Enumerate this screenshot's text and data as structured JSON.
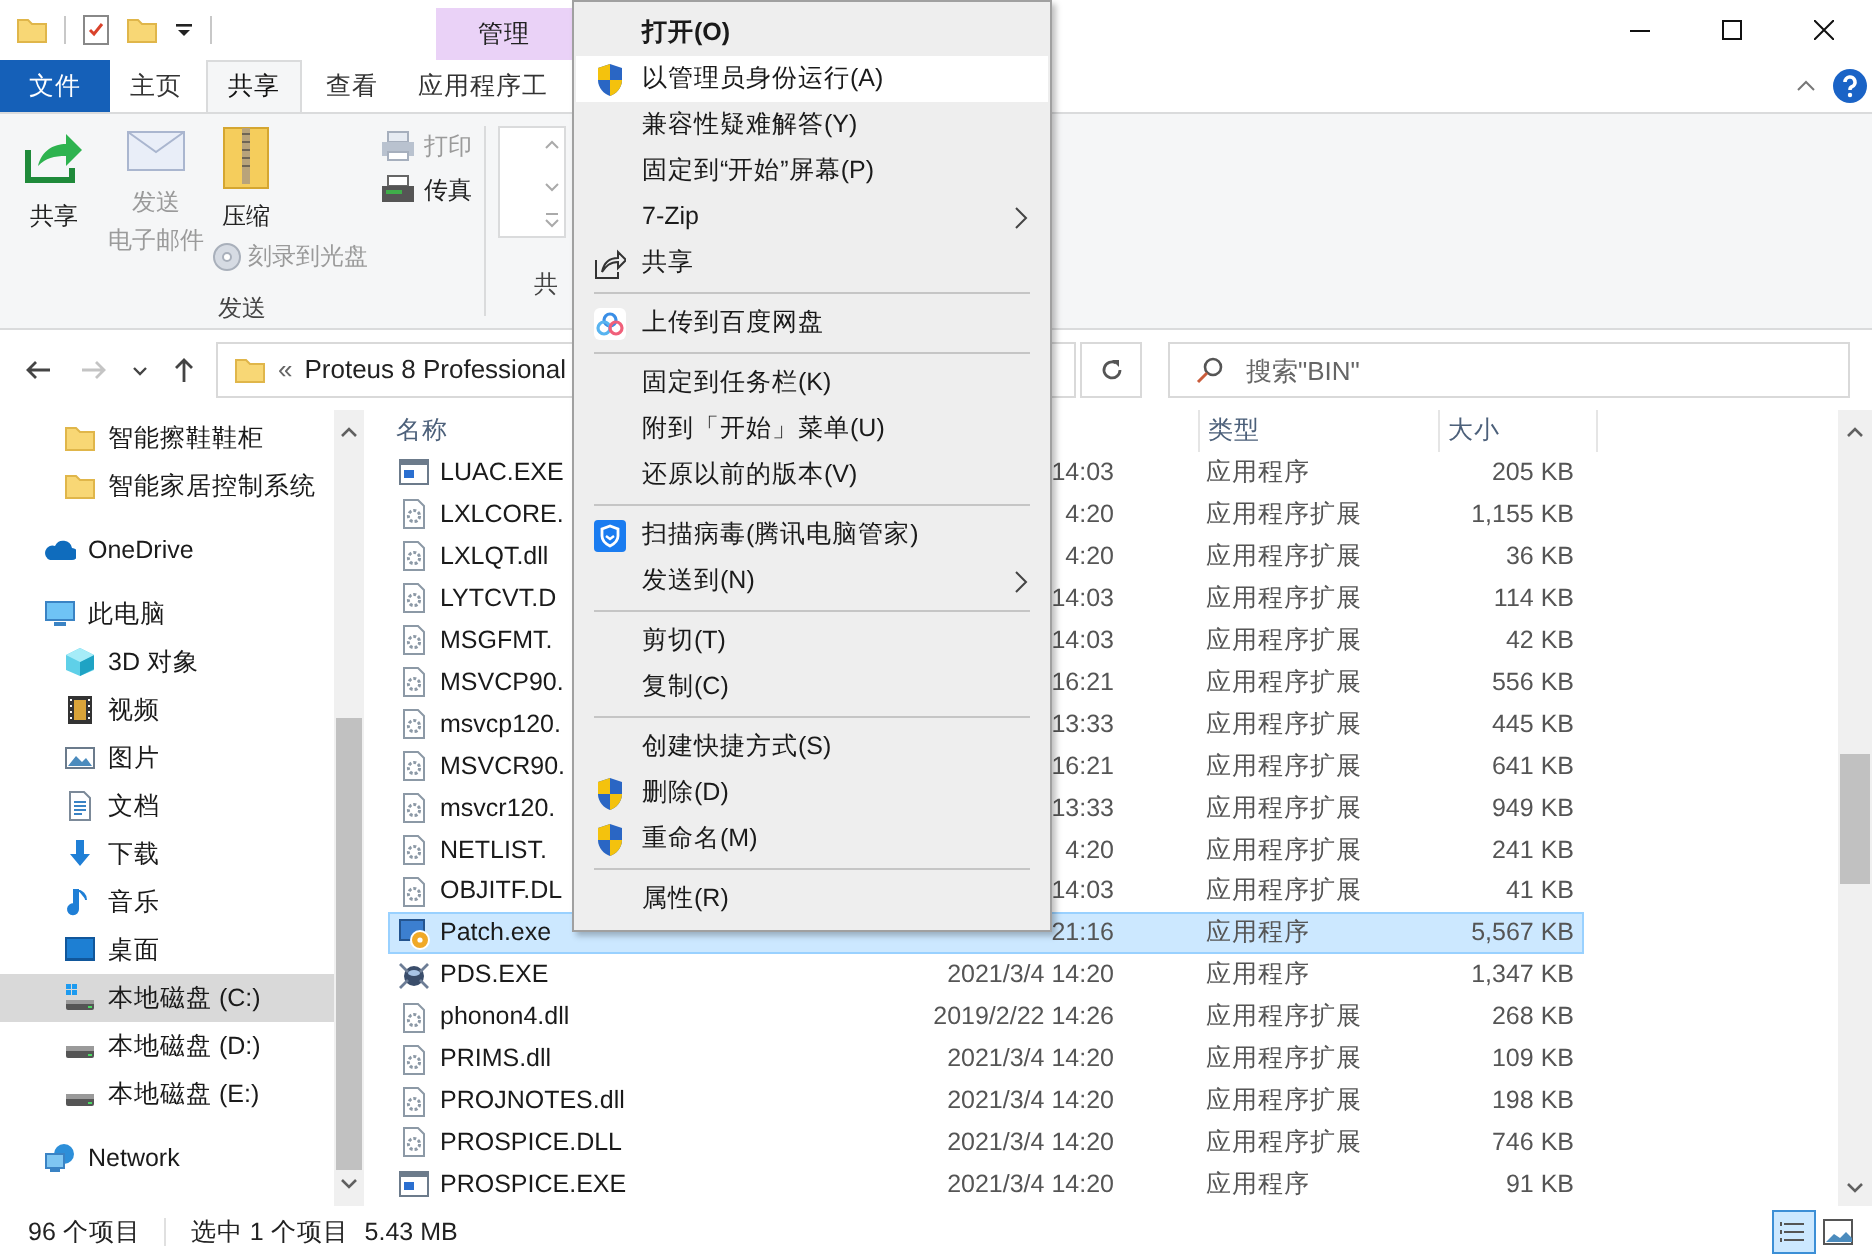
{
  "title_bar": {
    "context_tab": "管理"
  },
  "ribbon_tabs": [
    {
      "label": "文件",
      "kind": "file",
      "selected": false
    },
    {
      "label": "主页",
      "kind": "tab",
      "selected": false
    },
    {
      "label": "共享",
      "kind": "tab",
      "selected": true
    },
    {
      "label": "查看",
      "kind": "tab",
      "selected": false
    },
    {
      "label": "应用程序工",
      "kind": "tab",
      "selected": false
    }
  ],
  "ribbon": {
    "send_group": {
      "label": "发送",
      "share": {
        "label": "共享",
        "disabled": false
      },
      "email": {
        "lines": [
          "发送",
          "电子邮件"
        ],
        "disabled": true
      },
      "zip": {
        "label": "压缩",
        "disabled": false
      },
      "burn": {
        "label": "刻录到光盘",
        "disabled": true
      },
      "print": {
        "label": "打印",
        "disabled": true
      },
      "fax": {
        "label": "传真",
        "disabled": false
      }
    },
    "next_group": {
      "label": "共"
    }
  },
  "nav_buttons": [
    {
      "kind": "back",
      "disabled": false
    },
    {
      "kind": "forward",
      "disabled": true
    },
    {
      "kind": "recent",
      "disabled": false
    },
    {
      "kind": "up",
      "disabled": false
    }
  ],
  "address": {
    "prefix": "«",
    "path": "Proteus 8 Professional"
  },
  "search": {
    "placeholder": "搜索\"BIN\""
  },
  "nav_pane": {
    "scrolled_children": [
      {
        "label": "智能擦鞋鞋柜",
        "kind": "folder",
        "selected": false
      },
      {
        "label": "智能家居控制系统",
        "kind": "folder",
        "selected": false
      }
    ],
    "items": [
      {
        "label": "OneDrive",
        "kind": "cloud",
        "selected": false
      },
      {
        "label": "此电脑",
        "kind": "pc",
        "selected": false,
        "children": [
          {
            "label": "3D 对象",
            "kind": "cube",
            "selected": false
          },
          {
            "label": "视频",
            "kind": "video",
            "selected": false
          },
          {
            "label": "图片",
            "kind": "pictures",
            "selected": false
          },
          {
            "label": "文档",
            "kind": "documents",
            "selected": false
          },
          {
            "label": "下载",
            "kind": "downloads",
            "selected": false
          },
          {
            "label": "音乐",
            "kind": "music",
            "selected": false
          },
          {
            "label": "桌面",
            "kind": "desktop",
            "selected": false
          },
          {
            "label": "本地磁盘 (C:)",
            "kind": "system_drive",
            "selected": true
          },
          {
            "label": "本地磁盘 (D:)",
            "kind": "drive",
            "selected": false
          },
          {
            "label": "本地磁盘 (E:)",
            "kind": "drive",
            "selected": false
          }
        ]
      },
      {
        "label": "Network",
        "kind": "network",
        "selected": false
      }
    ]
  },
  "file_list": {
    "columns": [
      {
        "label": "名称",
        "kind": "name"
      },
      {
        "label": "类型",
        "kind": "type"
      },
      {
        "label": "大小",
        "kind": "size"
      }
    ],
    "rows": [
      {
        "name": "LUAC.EXE",
        "date": "14:03",
        "type": "应用程序",
        "size": "205 KB",
        "kind": "exe",
        "selected": false
      },
      {
        "name": "LXLCORE.",
        "date": "4:20",
        "type": "应用程序扩展",
        "size": "1,155 KB",
        "kind": "dll",
        "selected": false
      },
      {
        "name": "LXLQT.dll",
        "date": "4:20",
        "type": "应用程序扩展",
        "size": "36 KB",
        "kind": "dll",
        "selected": false
      },
      {
        "name": "LYTCVT.D",
        "date": "14:03",
        "type": "应用程序扩展",
        "size": "114 KB",
        "kind": "dll",
        "selected": false
      },
      {
        "name": "MSGFMT.",
        "date": "14:03",
        "type": "应用程序扩展",
        "size": "42 KB",
        "kind": "dll",
        "selected": false
      },
      {
        "name": "MSVCP90.",
        "date": "16:21",
        "type": "应用程序扩展",
        "size": "556 KB",
        "kind": "dll",
        "selected": false
      },
      {
        "name": "msvcp120.",
        "date": "13:33",
        "type": "应用程序扩展",
        "size": "445 KB",
        "kind": "dll",
        "selected": false
      },
      {
        "name": "MSVCR90.",
        "date": "16:21",
        "type": "应用程序扩展",
        "size": "641 KB",
        "kind": "dll",
        "selected": false
      },
      {
        "name": "msvcr120.",
        "date": "13:33",
        "type": "应用程序扩展",
        "size": "949 KB",
        "kind": "dll",
        "selected": false
      },
      {
        "name": "NETLIST.",
        "date": "4:20",
        "type": "应用程序扩展",
        "size": "241 KB",
        "kind": "dll",
        "selected": false
      },
      {
        "name": "OBJITF.DL",
        "date": "14:03",
        "type": "应用程序扩展",
        "size": "41 KB",
        "kind": "dll",
        "selected": false
      },
      {
        "name": "Patch.exe",
        "date": "21:16",
        "type": "应用程序",
        "size": "5,567 KB",
        "kind": "patch",
        "selected": true
      },
      {
        "name": "PDS.EXE",
        "date": "2021/3/4 14:20",
        "type": "应用程序",
        "size": "1,347 KB",
        "kind": "pds",
        "selected": false
      },
      {
        "name": "phonon4.dll",
        "date": "2019/2/22 14:26",
        "type": "应用程序扩展",
        "size": "268 KB",
        "kind": "dll",
        "selected": false
      },
      {
        "name": "PRIMS.dll",
        "date": "2021/3/4 14:20",
        "type": "应用程序扩展",
        "size": "109 KB",
        "kind": "dll",
        "selected": false
      },
      {
        "name": "PROJNOTES.dll",
        "date": "2021/3/4 14:20",
        "type": "应用程序扩展",
        "size": "198 KB",
        "kind": "dll",
        "selected": false
      },
      {
        "name": "PROSPICE.DLL",
        "date": "2021/3/4 14:20",
        "type": "应用程序扩展",
        "size": "746 KB",
        "kind": "dll",
        "selected": false
      },
      {
        "name": "PROSPICE.EXE",
        "date": "2021/3/4 14:20",
        "type": "应用程序",
        "size": "91 KB",
        "kind": "exe",
        "selected": false
      }
    ]
  },
  "status_bar": {
    "item_count": "96 个项目",
    "selection": "选中 1 个项目",
    "selection_size": "5.43 MB",
    "views": [
      {
        "kind": "details",
        "selected": true
      },
      {
        "kind": "large_icons",
        "selected": false
      }
    ]
  },
  "context_menu": {
    "groups": [
      [
        {
          "label": "打开(O)",
          "kind": "plain",
          "default": true,
          "selected": false,
          "submenu": false
        },
        {
          "label": "以管理员身份运行(A)",
          "kind": "elevated",
          "default": false,
          "selected": true,
          "submenu": false
        },
        {
          "label": "兼容性疑难解答(Y)",
          "kind": "plain",
          "default": false,
          "selected": false,
          "submenu": false
        },
        {
          "label": "固定到“开始”屏幕(P)",
          "kind": "plain",
          "default": false,
          "selected": false,
          "submenu": false
        },
        {
          "label": "7-Zip",
          "kind": "plain",
          "default": false,
          "selected": false,
          "submenu": true
        },
        {
          "label": "共享",
          "kind": "share",
          "default": false,
          "selected": false,
          "submenu": false
        }
      ],
      [
        {
          "label": "上传到百度网盘",
          "kind": "cloud",
          "default": false,
          "selected": false,
          "submenu": false
        }
      ],
      [
        {
          "label": "固定到任务栏(K)",
          "kind": "plain",
          "default": false,
          "selected": false,
          "submenu": false
        },
        {
          "label": "附到「开始」菜单(U)",
          "kind": "plain",
          "default": false,
          "selected": false,
          "submenu": false
        },
        {
          "label": "还原以前的版本(V)",
          "kind": "plain",
          "default": false,
          "selected": false,
          "submenu": false
        }
      ],
      [
        {
          "label": "扫描病毒(腾讯电脑管家)",
          "kind": "antivirus",
          "default": false,
          "selected": false,
          "submenu": false
        },
        {
          "label": "发送到(N)",
          "kind": "plain",
          "default": false,
          "selected": false,
          "submenu": true
        }
      ],
      [
        {
          "label": "剪切(T)",
          "kind": "plain",
          "default": false,
          "selected": false,
          "submenu": false
        },
        {
          "label": "复制(C)",
          "kind": "plain",
          "default": false,
          "selected": false,
          "submenu": false
        }
      ],
      [
        {
          "label": "创建快捷方式(S)",
          "kind": "plain",
          "default": false,
          "selected": false,
          "submenu": false
        },
        {
          "label": "删除(D)",
          "kind": "elevated",
          "default": false,
          "selected": false,
          "submenu": false
        },
        {
          "label": "重命名(M)",
          "kind": "elevated",
          "default": false,
          "selected": false,
          "submenu": false
        }
      ],
      [
        {
          "label": "属性(R)",
          "kind": "plain",
          "default": false,
          "selected": false,
          "submenu": false
        }
      ]
    ]
  }
}
